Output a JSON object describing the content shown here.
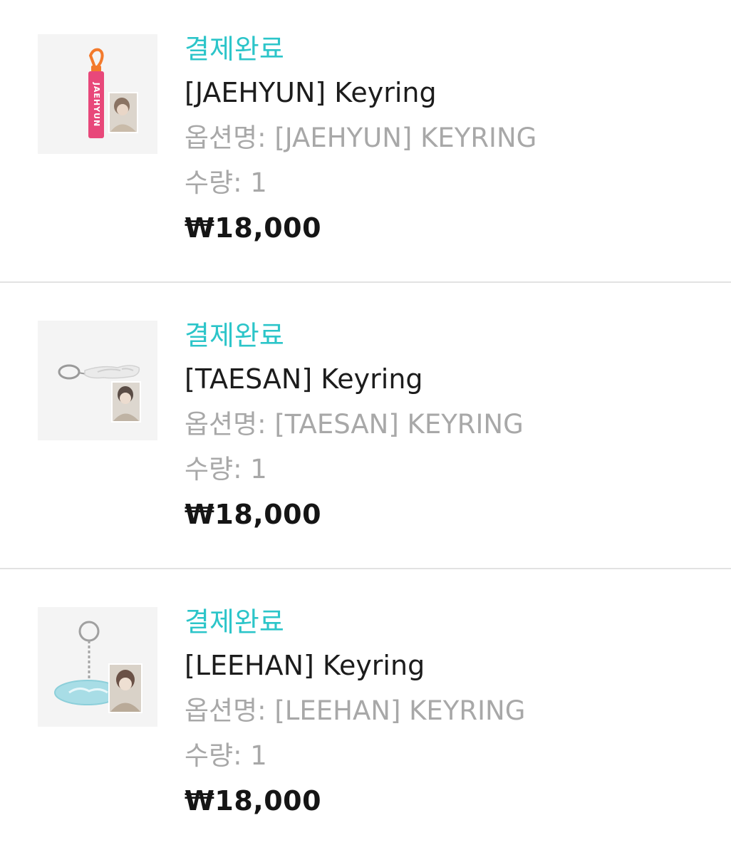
{
  "colors": {
    "status": "#2cc5c9",
    "title": "#1c1c1c",
    "muted": "#a8a8a8",
    "price": "#151515",
    "divider": "#e2e2e2"
  },
  "orders": [
    {
      "status": "결제완료",
      "name": "[JAEHYUN] Keyring",
      "option": "옵션명: [JAEHYUN] KEYRING",
      "quantity": "수량: 1",
      "price": "₩18,000",
      "image_icon": "jaehyun-strap-keyring-product-icon",
      "strap_text": "JAEHYUN"
    },
    {
      "status": "결제완료",
      "name": "[TAESAN] Keyring",
      "option": "옵션명: [TAESAN] KEYRING",
      "quantity": "수량: 1",
      "price": "₩18,000",
      "image_icon": "taesan-acrylic-keyring-product-icon"
    },
    {
      "status": "결제완료",
      "name": "[LEEHAN] Keyring",
      "option": "옵션명: [LEEHAN] KEYRING",
      "quantity": "수량: 1",
      "price": "₩18,000",
      "image_icon": "leehan-acrylic-keyring-product-icon"
    }
  ]
}
